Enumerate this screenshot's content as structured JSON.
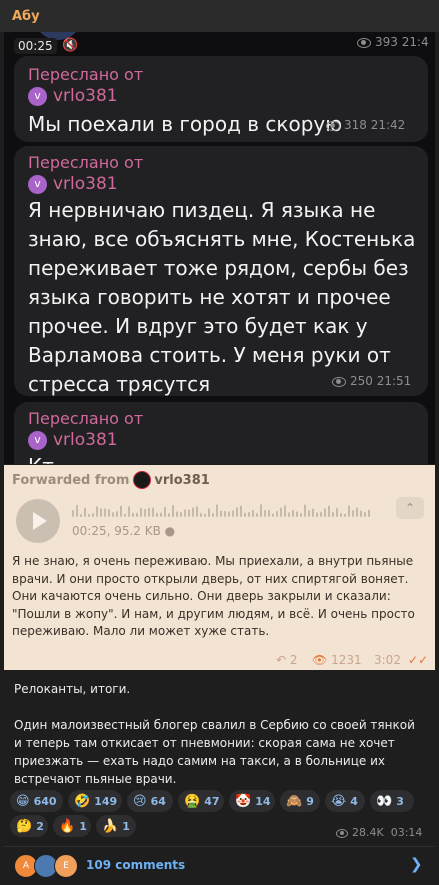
{
  "chat": {
    "name": "Абу"
  },
  "screenshot": {
    "video": {
      "time": "00:25",
      "views": "393",
      "time_posted": "21:4"
    },
    "messages": [
      {
        "forwarded_label": "Переслано от",
        "avatar_letter": "v",
        "source": "vrlo381",
        "text": "Мы поехали в город в скорую",
        "views": "318",
        "time": "21:42"
      },
      {
        "forwarded_label": "Переслано от",
        "avatar_letter": "v",
        "source": "vrlo381",
        "text": "Я нервничаю пиздец. Я языка не знаю, все объяснять мне, Костенька переживает тоже рядом, сербы без языка говорить не хотят и прочее прочее. И вдруг это будет как у Варламова стоить. У меня руки от стресса трясутся",
        "views": "250",
        "time": "21:51"
      },
      {
        "forwarded_label": "Переслано от",
        "avatar_letter": "v",
        "source": "vrlo381",
        "text_partial": "Кт"
      }
    ]
  },
  "forwarded_audio": {
    "header_label": "Forwarded from",
    "source": "vrlo381",
    "info": "00:25, 95.2 KB",
    "transcript": "Я не знаю, я очень переживаю. Мы приехали, а внутри пьяные врачи. И они просто открыли дверь, от них спиртягой воняет. Они качаются очень сильно. Они дверь закрыли и сказали: \"Пошли в жопу\". И нам, и другим людям, и всё. И очень просто переживаю. Мало ли может хуже стать.",
    "replies": "2",
    "views": "1231",
    "time": "3:02"
  },
  "post": {
    "title": "Релоканты, итоги.",
    "body": "Один малоизвестный блогер свалил в Сербию со своей тянкой и теперь там откисает от пневмонии: скорая сама не хочет приезжать — ехать надо самим на такси, а в больнице их встречают пьяные врачи.",
    "reactions": [
      {
        "emoji": "😁",
        "count": "640"
      },
      {
        "emoji": "🤣",
        "count": "149"
      },
      {
        "emoji": "😢",
        "count": "64"
      },
      {
        "emoji": "🤮",
        "count": "47"
      },
      {
        "emoji": "🤡",
        "count": "14"
      },
      {
        "emoji": "🙈",
        "count": "9"
      },
      {
        "emoji": "😭",
        "count": "4"
      },
      {
        "emoji": "👀",
        "count": "3"
      },
      {
        "emoji": "🤔",
        "count": "2"
      },
      {
        "emoji": "🔥",
        "count": "1"
      },
      {
        "emoji": "🍌",
        "count": "1"
      }
    ],
    "views": "28.4K",
    "time": "03:14",
    "comments_label": "109 comments",
    "commenter_letters": [
      "A",
      "",
      "E"
    ]
  }
}
